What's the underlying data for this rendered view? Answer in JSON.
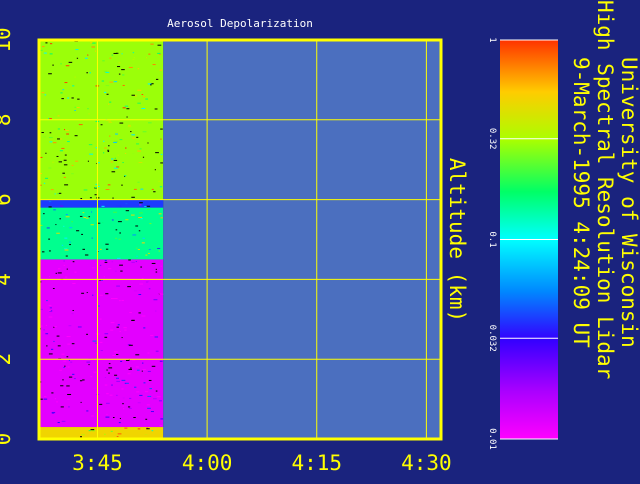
{
  "chart_data": {
    "type": "heatmap",
    "title": "Aerosol Depolarization",
    "ylabel": "Altitude (km)",
    "ylim": [
      0,
      10
    ],
    "yticks": [
      "0",
      "2",
      "4",
      "6",
      "8",
      "10"
    ],
    "xticks": [
      "3:45",
      "4:00",
      "4:15",
      "4:30"
    ],
    "xtick_values_min": [
      225,
      240,
      255,
      270
    ],
    "xlim_min": [
      217,
      272
    ],
    "data_end_min": 234,
    "grid": true,
    "colorbar": {
      "scale": "log",
      "range": [
        0.01,
        1
      ],
      "ticks": [
        "1",
        "0.32",
        "0.1",
        "0.032",
        "0.01"
      ],
      "tick_values": [
        1,
        0.32,
        0.1,
        0.032,
        0.01
      ]
    },
    "layers": [
      {
        "alt_from": 0.0,
        "alt_to": 0.3,
        "depolarization": 0.5
      },
      {
        "alt_from": 0.3,
        "alt_to": 4.5,
        "depolarization": 0.012
      },
      {
        "alt_from": 4.5,
        "alt_to": 5.8,
        "depolarization": 0.15
      },
      {
        "alt_from": 5.8,
        "alt_to": 6.0,
        "depolarization": 0.04
      },
      {
        "alt_from": 6.0,
        "alt_to": 10.0,
        "depolarization": 0.3
      }
    ]
  },
  "instrument": {
    "line1": "University of Wisconsin",
    "line2": "High Spectral Resolution Lidar",
    "line3": "9-March-1995   4:24:09 UT"
  },
  "colors": {
    "background": "#1a237e",
    "frame": "#ffff00",
    "no_data": "#4b6fbf"
  }
}
